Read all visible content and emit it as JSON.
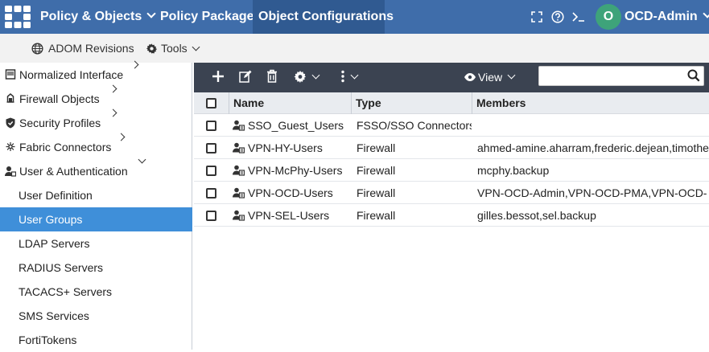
{
  "topbar": {
    "nav": [
      "Policy & Objects",
      "Policy Packages",
      "Object Configurations"
    ],
    "user": "OCD-Admin",
    "avatar_letter": "O",
    "icons": [
      "fullscreen-icon",
      "help-icon",
      "console-icon"
    ],
    "color": "#3f6daa"
  },
  "subbar": {
    "adom_revisions": "ADOM Revisions",
    "tools": "Tools"
  },
  "sidebar": {
    "items": [
      {
        "label": "Normalized Interface",
        "icon": "interface-icon"
      },
      {
        "label": "Firewall Objects",
        "icon": "firewall-icon"
      },
      {
        "label": "Security Profiles",
        "icon": "shield-icon"
      },
      {
        "label": "Fabric Connectors",
        "icon": "connector-icon"
      },
      {
        "label": "User & Authentication",
        "icon": "user-icon"
      },
      {
        "label": "User Definition"
      },
      {
        "label": "User Groups",
        "selected": true
      },
      {
        "label": "LDAP Servers"
      },
      {
        "label": "RADIUS Servers"
      },
      {
        "label": "TACACS+ Servers"
      },
      {
        "label": "SMS Services"
      },
      {
        "label": "FortiTokens"
      }
    ],
    "selected_color": "#3f8fd9"
  },
  "toolbar": {
    "view_label": "View",
    "search_placeholder": "",
    "icons": [
      "add-icon",
      "edit-icon",
      "delete-icon",
      "gear-icon",
      "more-icon"
    ]
  },
  "table": {
    "columns": [
      "Name",
      "Type",
      "Members"
    ],
    "rows": [
      {
        "name": "SSO_Guest_Users",
        "type": "FSSO/SSO Connectors",
        "members": ""
      },
      {
        "name": "VPN-HY-Users",
        "type": "Firewall",
        "members": "ahmed-amine.aharram,frederic.dejean,timotheo"
      },
      {
        "name": "VPN-McPhy-Users",
        "type": "Firewall",
        "members": "mcphy.backup"
      },
      {
        "name": "VPN-OCD-Users",
        "type": "Firewall",
        "members": "VPN-OCD-Admin,VPN-OCD-PMA,VPN-OCD-"
      },
      {
        "name": "VPN-SEL-Users",
        "type": "Firewall",
        "members": "gilles.bessot,sel.backup"
      }
    ]
  }
}
